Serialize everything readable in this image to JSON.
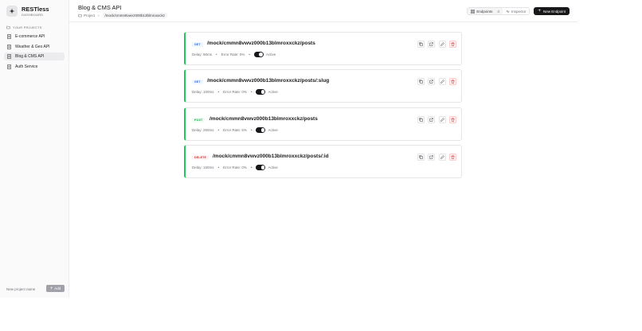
{
  "brand": {
    "name": "RESTless",
    "subtitle": "DASHBOARD"
  },
  "sidebar": {
    "heading": "YOUR PROJECTS",
    "items": [
      {
        "label": "E-commerce API",
        "active": false
      },
      {
        "label": "Weather & Geo API",
        "active": false
      },
      {
        "label": "Blog & CMS API",
        "active": true
      },
      {
        "label": "Auth Service",
        "active": false
      }
    ],
    "new_project_placeholder": "New project name",
    "add_label": "Add"
  },
  "header": {
    "title": "Blog & CMS API",
    "breadcrumb_root": "Project",
    "breadcrumb_path": "/mock/cmmn8vwvz000b13blmroxxckz",
    "tab_endpoints": "Endpoints",
    "endpoints_count": "4",
    "tab_inspector": "Inspector",
    "new_endpoint_label": "New Endpoint"
  },
  "endpoints": [
    {
      "method": "GET",
      "path": "/mock/cmmn8vwvz000b13blmroxxckz/posts",
      "delay": "Delay: 90ms",
      "error_rate": "Error Rate: 0%",
      "status": "Active"
    },
    {
      "method": "GET",
      "path": "/mock/cmmn8vwvz000b13blmroxxckz/posts/:slug",
      "delay": "Delay: 100ms",
      "error_rate": "Error Rate: 0%",
      "status": "Active"
    },
    {
      "method": "POST",
      "path": "/mock/cmmn8vwvz000b13blmroxxckz/posts",
      "delay": "Delay: 250ms",
      "error_rate": "Error Rate: 5%",
      "status": "Active"
    },
    {
      "method": "DELETE",
      "path": "/mock/cmmn8vwvz000b13blmroxxckz/posts/:id",
      "delay": "Delay: 150ms",
      "error_rate": "Error Rate: 0%",
      "status": "Active"
    }
  ],
  "colors": {
    "active_accent": "#22c55e",
    "primary_button": "#18181b",
    "delete_red": "#dc2626"
  }
}
